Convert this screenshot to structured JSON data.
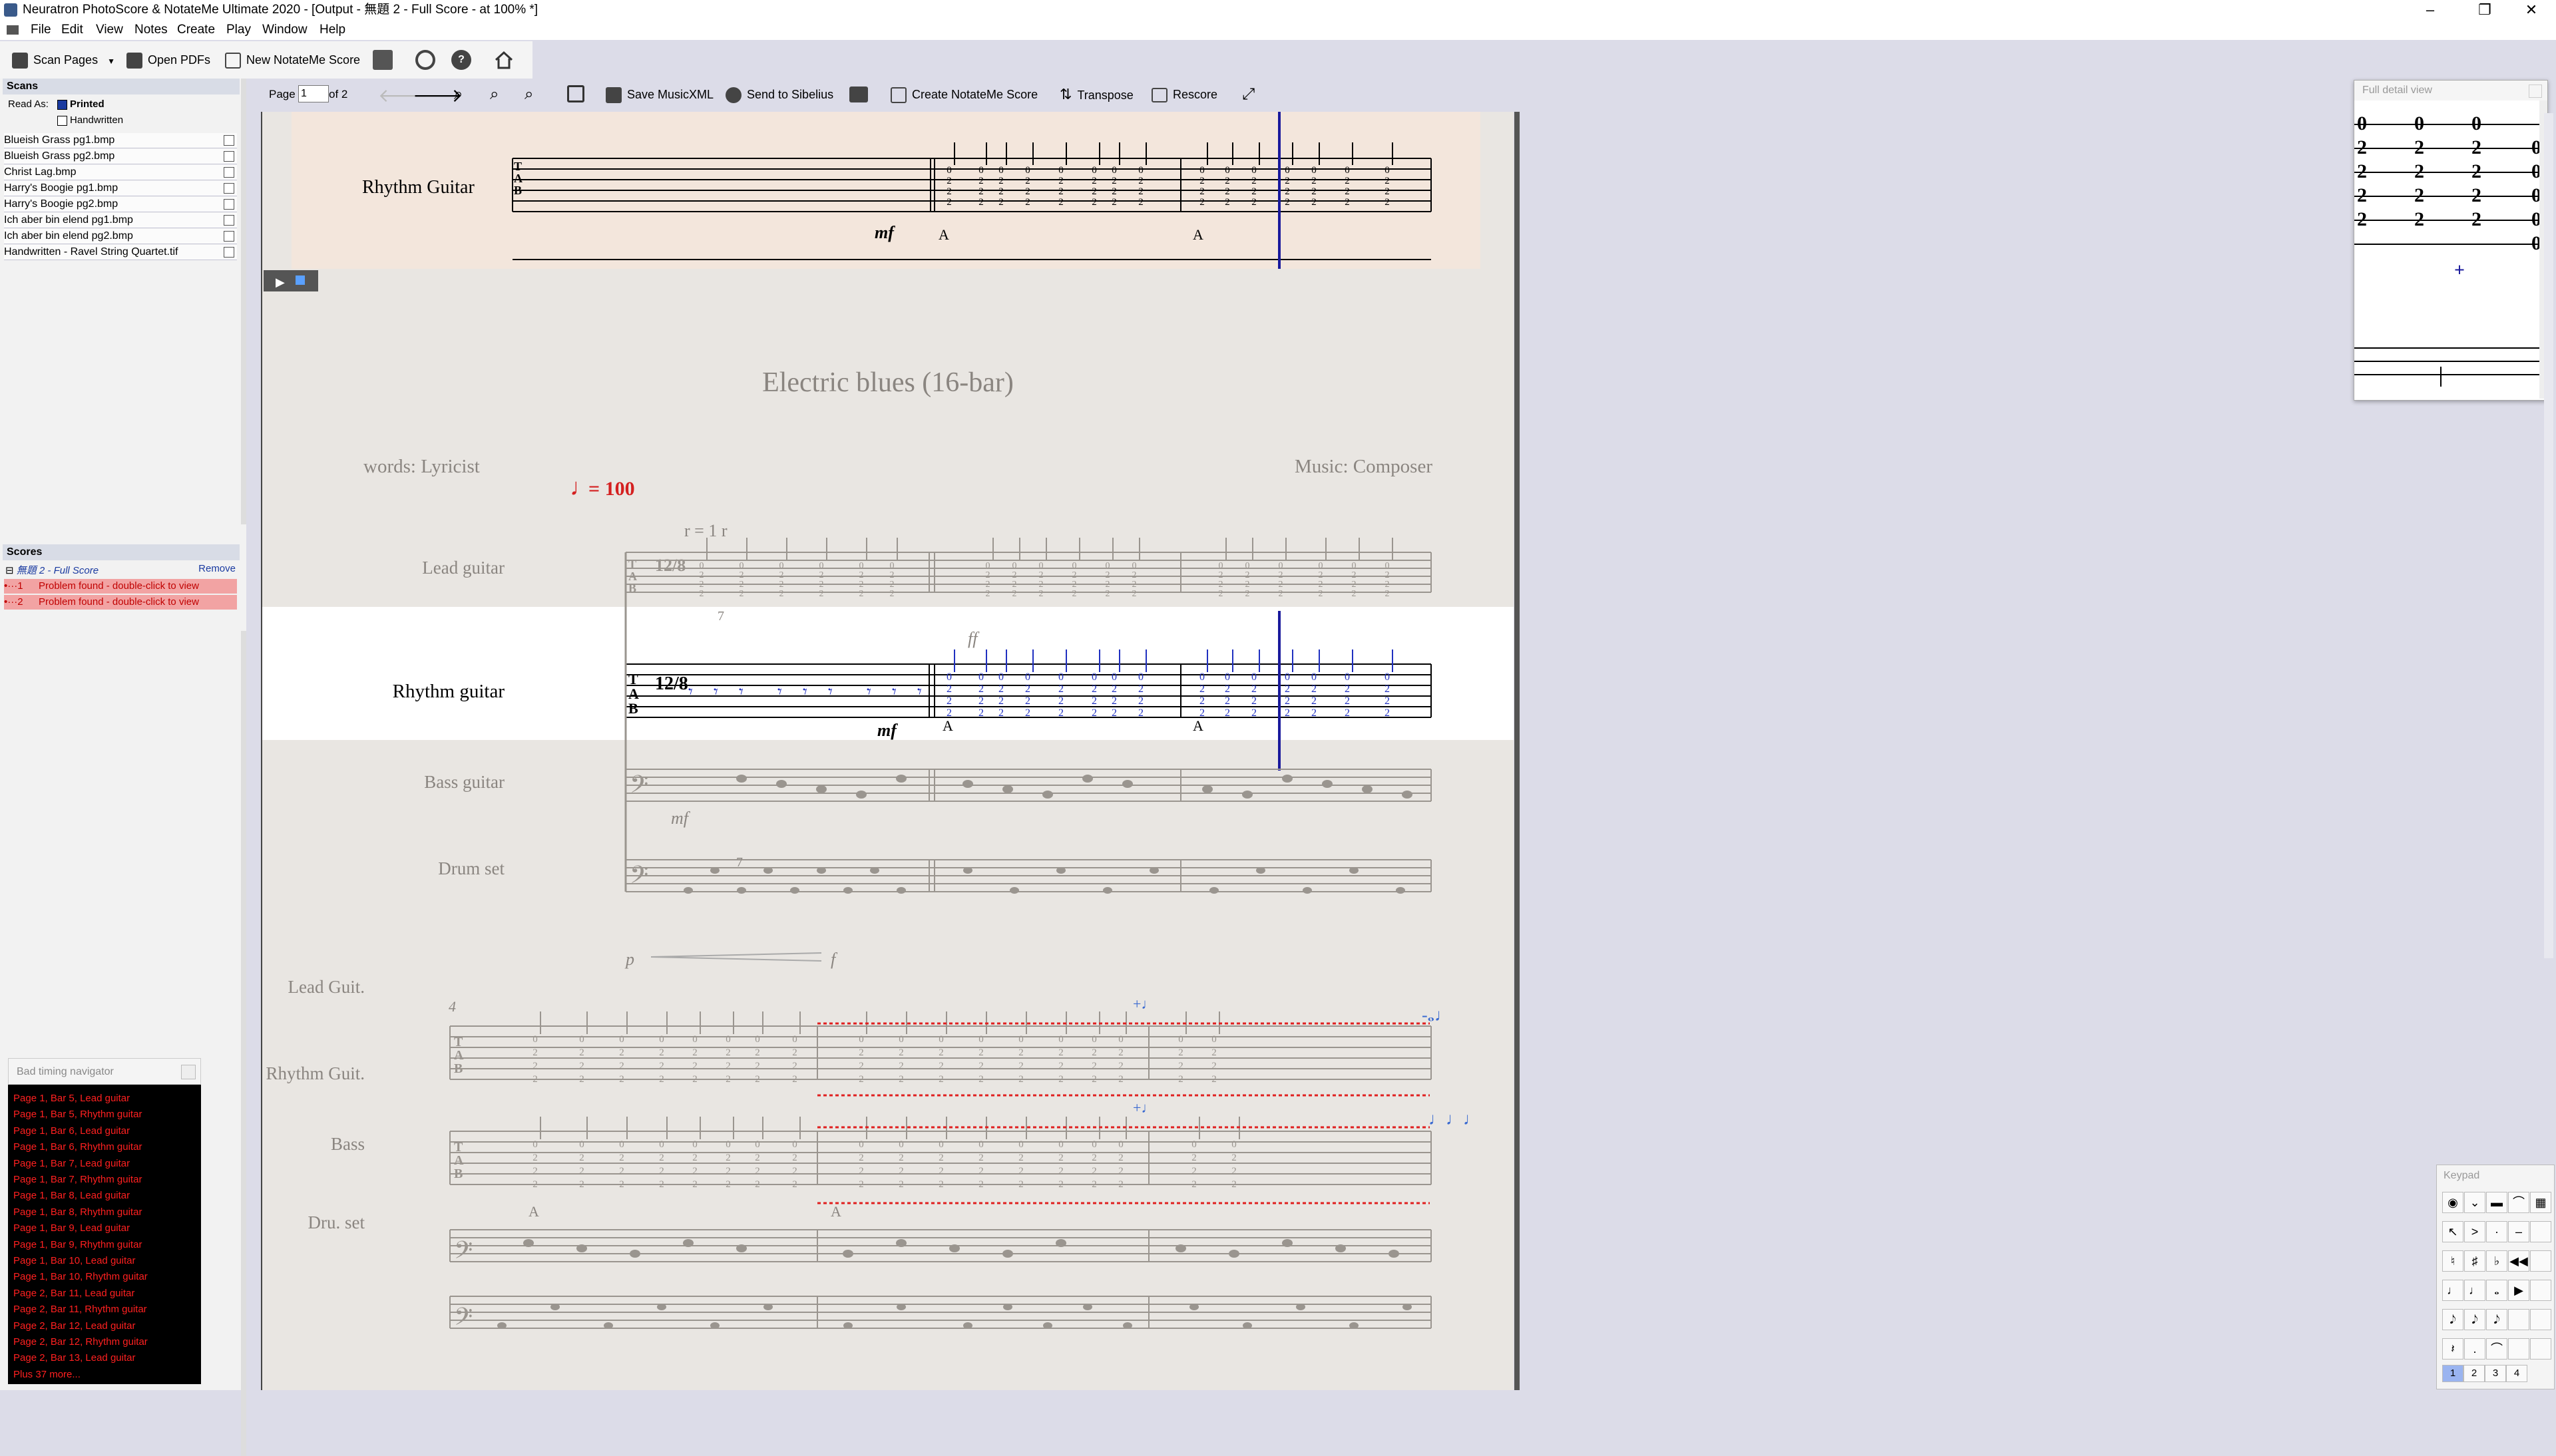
{
  "window": {
    "title": "Neuratron PhotoScore & NotateMe Ultimate 2020 - [Output - 無題 2 - Full Score - at 100% *]",
    "controls": [
      "–",
      "❐",
      "✕"
    ]
  },
  "menu": [
    "File",
    "Edit",
    "View",
    "Notes",
    "Create",
    "Play",
    "Window",
    "Help"
  ],
  "toolbar": {
    "scan_pages": "Scan Pages",
    "open_pdfs": "Open PDFs",
    "new_notateme": "New NotateMe Score"
  },
  "pagebar": {
    "page_label": "Page",
    "page_value": "1",
    "of_label": "of 2",
    "save_musicxml": "Save MusicXML",
    "send_to_sibelius": "Send to Sibelius",
    "create_notateme": "Create NotateMe Score",
    "transpose": "Transpose",
    "rescore": "Rescore"
  },
  "scans": {
    "title": "Scans",
    "read_as_label": "Read As:",
    "printed": "Printed",
    "handwritten": "Handwritten",
    "items": [
      "Blueish Grass pg1.bmp",
      "Blueish Grass pg2.bmp",
      "Christ Lag.bmp",
      "Harry's Boogie pg1.bmp",
      "Harry's Boogie pg2.bmp",
      "Ich aber bin elend pg1.bmp",
      "Ich aber bin elend pg2.bmp",
      "Handwritten - Ravel String Quartet.tif"
    ]
  },
  "scores": {
    "title": "Scores",
    "score_name": "無題 2 - Full Score",
    "remove": "Remove",
    "problems": [
      {
        "num": "•···1",
        "text": "Problem found - double-click to view"
      },
      {
        "num": "•···2",
        "text": "Problem found - double-click to view"
      }
    ]
  },
  "timing_navigator": {
    "title": "Bad timing navigator",
    "items": [
      "Page 1, Bar 5, Lead guitar",
      "Page 1, Bar 5, Rhythm guitar",
      "Page 1, Bar 6, Lead guitar",
      "Page 1, Bar 6, Rhythm guitar",
      "Page 1, Bar 7, Lead guitar",
      "Page 1, Bar 7, Rhythm guitar",
      "Page 1, Bar 8, Lead guitar",
      "Page 1, Bar 8, Rhythm guitar",
      "Page 1, Bar 9, Lead guitar",
      "Page 1, Bar 9, Rhythm guitar",
      "Page 1, Bar 10, Lead guitar",
      "Page 1, Bar 10, Rhythm guitar",
      "Page 2, Bar 11, Lead guitar",
      "Page 2, Bar 11, Rhythm guitar",
      "Page 2, Bar 12, Lead guitar",
      "Page 2, Bar 12, Rhythm guitar",
      "Page 2, Bar 13, Lead guitar",
      "Plus 37 more..."
    ]
  },
  "score": {
    "title": "Electric blues (16-bar)",
    "words": "words: Lyricist",
    "music": "Music: Composer",
    "tempo": "= 100",
    "swing": "r = 1 r",
    "top_strip_instrument": "Rhythm Guitar",
    "top_dynamic": "mf",
    "chord_a": "A",
    "instruments_sys1": [
      "Lead guitar",
      "Rhythm guitar",
      "Bass guitar",
      "Drum set"
    ],
    "instruments_sys2": [
      "Lead Guit.",
      "Rhythm Guit.",
      "Bass",
      "Dru. set"
    ],
    "dynamics": {
      "ff": "ff",
      "mf": "mf",
      "p": "p",
      "f": "f"
    },
    "tuplet": "7",
    "bar_number": "4",
    "time_sig": "12/8",
    "tab": "TAB"
  },
  "detail_view": {
    "title": "Full detail view",
    "tab_digits": [
      [
        "0",
        "0",
        "0"
      ],
      [
        "2",
        "2",
        "2",
        "0"
      ],
      [
        "2",
        "2",
        "2",
        "0"
      ],
      [
        "2",
        "2",
        "2",
        "0"
      ],
      [
        "2",
        "2",
        "2",
        "0"
      ],
      [
        "",
        "",
        "",
        "0"
      ]
    ]
  },
  "keypad": {
    "title": "Keypad",
    "tabs": [
      "1",
      "2",
      "3",
      "4"
    ]
  },
  "colors": {
    "selected_staff": "#ffffff",
    "cursor": "#1a1a9c",
    "problem": "#e02020",
    "note_blue": "#2030c0"
  }
}
